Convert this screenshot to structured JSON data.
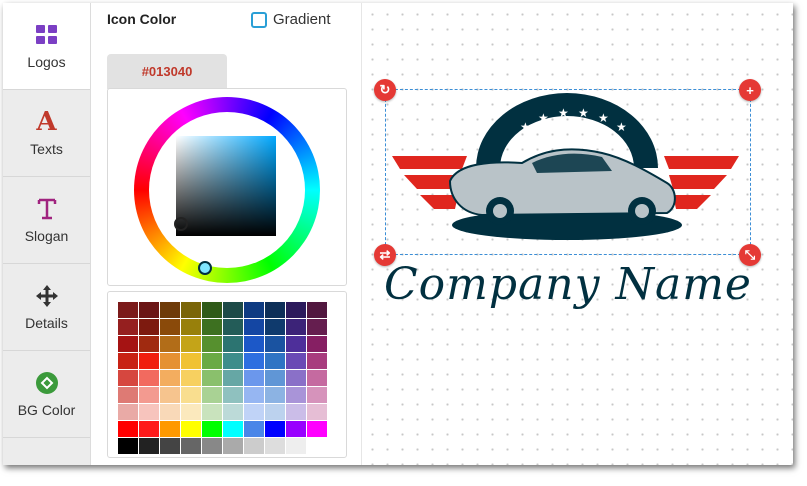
{
  "sidebar": {
    "items": [
      {
        "label": "Logos",
        "icon": "grid-icon",
        "active": true
      },
      {
        "label": "Texts",
        "icon": "letter-a-icon",
        "active": false
      },
      {
        "label": "Slogan",
        "icon": "text-cursor-icon",
        "active": false
      },
      {
        "label": "Details",
        "icon": "move-arrows-icon",
        "active": false
      },
      {
        "label": "BG Color",
        "icon": "bg-color-icon",
        "active": false
      }
    ]
  },
  "panel": {
    "title": "Icon Color",
    "gradient_label": "Gradient",
    "hex_value": "#013040"
  },
  "palette": [
    [
      "#7b1a1a",
      "#6b1515",
      "#6e3b09",
      "#7a6508",
      "#2f5a18",
      "#1d4a47",
      "#0e3b82",
      "#0d2f58",
      "#2c1a5c",
      "#51173f"
    ],
    [
      "#951f1f",
      "#7d1a0f",
      "#8a4a0a",
      "#98800b",
      "#3d7020",
      "#235c58",
      "#1446a3",
      "#0f3a6d",
      "#3c2378",
      "#651e4f"
    ],
    [
      "#a51313",
      "#a02a10",
      "#b26d18",
      "#c4a418",
      "#56902e",
      "#2c7471",
      "#1c58c8",
      "#1a53a1",
      "#4e2f9a",
      "#861f63"
    ],
    [
      "#c82214",
      "#f01e0e",
      "#e59133",
      "#f0c233",
      "#6aaa45",
      "#3e8d8b",
      "#2e6fe0",
      "#2f74c4",
      "#6a4ab5",
      "#a83c7e"
    ],
    [
      "#d6473f",
      "#f26a5f",
      "#f3ad5f",
      "#f7d060",
      "#8ac06c",
      "#66a7a5",
      "#6b97ec",
      "#6096d6",
      "#8a70c8",
      "#c56aa0"
    ],
    [
      "#de7a74",
      "#f39a90",
      "#f6c48e",
      "#f9de8f",
      "#a9d294",
      "#8fc1bf",
      "#96b6f2",
      "#8cb3e3",
      "#a994d8",
      "#d693bb"
    ],
    [
      "#e9aaa6",
      "#f7c4bd",
      "#f9d9b8",
      "#fbe9bd",
      "#c9e3bd",
      "#bcdad8",
      "#c0d3f7",
      "#bcd2ee",
      "#cbbde8",
      "#e6bed5"
    ],
    [
      "#ff0000",
      "#ff1a1a",
      "#ff9900",
      "#ffff00",
      "#00ff00",
      "#00ffff",
      "#4a86e8",
      "#0000ff",
      "#9900ff",
      "#ff00ff"
    ],
    [
      "#000000",
      "#222222",
      "#444444",
      "#666666",
      "#888888",
      "#aaaaaa",
      "#cccccc",
      "#dddddd",
      "#eeeeee",
      "#ffffff"
    ]
  ],
  "canvas": {
    "company_name": "Company Name",
    "logo_colors": {
      "primary": "#013040",
      "accent": "#e0261e",
      "car": "#b9c3c8"
    }
  }
}
